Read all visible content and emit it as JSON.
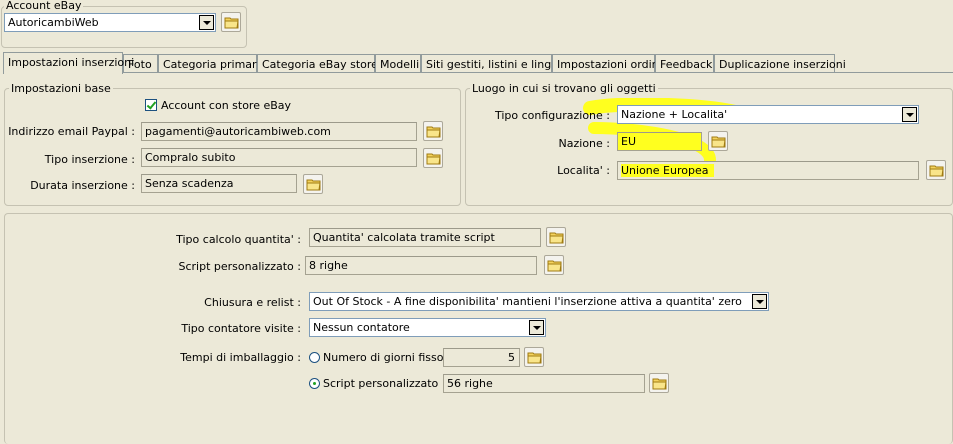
{
  "account": {
    "legend": "Account eBay",
    "selected": "AutoricambiWeb"
  },
  "tabs": [
    {
      "label": "Impostazioni inserzioni",
      "active": true
    },
    {
      "label": "Foto"
    },
    {
      "label": "Categoria primaria"
    },
    {
      "label": "Categoria eBay store"
    },
    {
      "label": "Modelli"
    },
    {
      "label": "Siti gestiti, listini e lingue"
    },
    {
      "label": "Impostazioni ordini"
    },
    {
      "label": "Feedback"
    },
    {
      "label": "Duplicazione inserzioni"
    }
  ],
  "base": {
    "legend": "Impostazioni base",
    "store_checkbox_label": "Account con store eBay",
    "paypal_label": "Indirizzo email Paypal :",
    "paypal_value": "pagamenti@autoricambiweb.com",
    "tipo_label": "Tipo inserzione :",
    "tipo_value": "Compralo subito",
    "durata_label": "Durata inserzione :",
    "durata_value": "Senza scadenza"
  },
  "luogo": {
    "legend": "Luogo in cui si trovano gli oggetti",
    "config_label": "Tipo configurazione :",
    "config_value": "Nazione + Localita'",
    "nazione_label": "Nazione :",
    "nazione_value": "EU",
    "localita_label": "Localita' :",
    "localita_value": "Unione Europea"
  },
  "quantity": {
    "calc_label": "Tipo calcolo quantita' :",
    "calc_value": "Quantita' calcolata tramite script",
    "script_label": "Script personalizzato :",
    "script_value": "8 righe",
    "relist_label": "Chiusura e relist :",
    "relist_value": "Out Of Stock - A fine disponibilita' mantieni l'inserzione attiva a quantita' zero",
    "contatore_label": "Tipo contatore visite :",
    "contatore_value": "Nessun contatore",
    "imballaggio_label": "Tempi di imballaggio :",
    "radio_giorni_label": "Numero di giorni fisso",
    "giorni_value": "5",
    "radio_script_label": "Script personalizzato",
    "script2_value": "56 righe"
  },
  "colors": {
    "highlight": "#ffff1f",
    "window_bg": "#ece9d8",
    "check_green": "#21a121"
  }
}
